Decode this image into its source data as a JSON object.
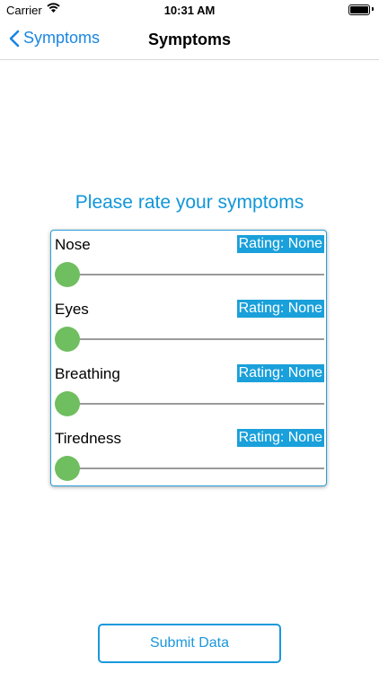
{
  "status_bar": {
    "carrier": "Carrier",
    "time": "10:31 AM"
  },
  "nav": {
    "back_label": "Symptoms",
    "title": "Symptoms"
  },
  "heading": "Please rate your symptoms",
  "symptoms": [
    {
      "label": "Nose",
      "rating": "Rating: None",
      "slider_value": 0
    },
    {
      "label": "Eyes",
      "rating": "Rating: None",
      "slider_value": 0
    },
    {
      "label": "Breathing",
      "rating": "Rating: None",
      "slider_value": 0
    },
    {
      "label": "Tiredness",
      "rating": "Rating: None",
      "slider_value": 0
    }
  ],
  "submit_label": "Submit Data",
  "colors": {
    "accent": "#1a98dc",
    "thumb": "#6fbe5f",
    "badge": "#1aa0da"
  }
}
